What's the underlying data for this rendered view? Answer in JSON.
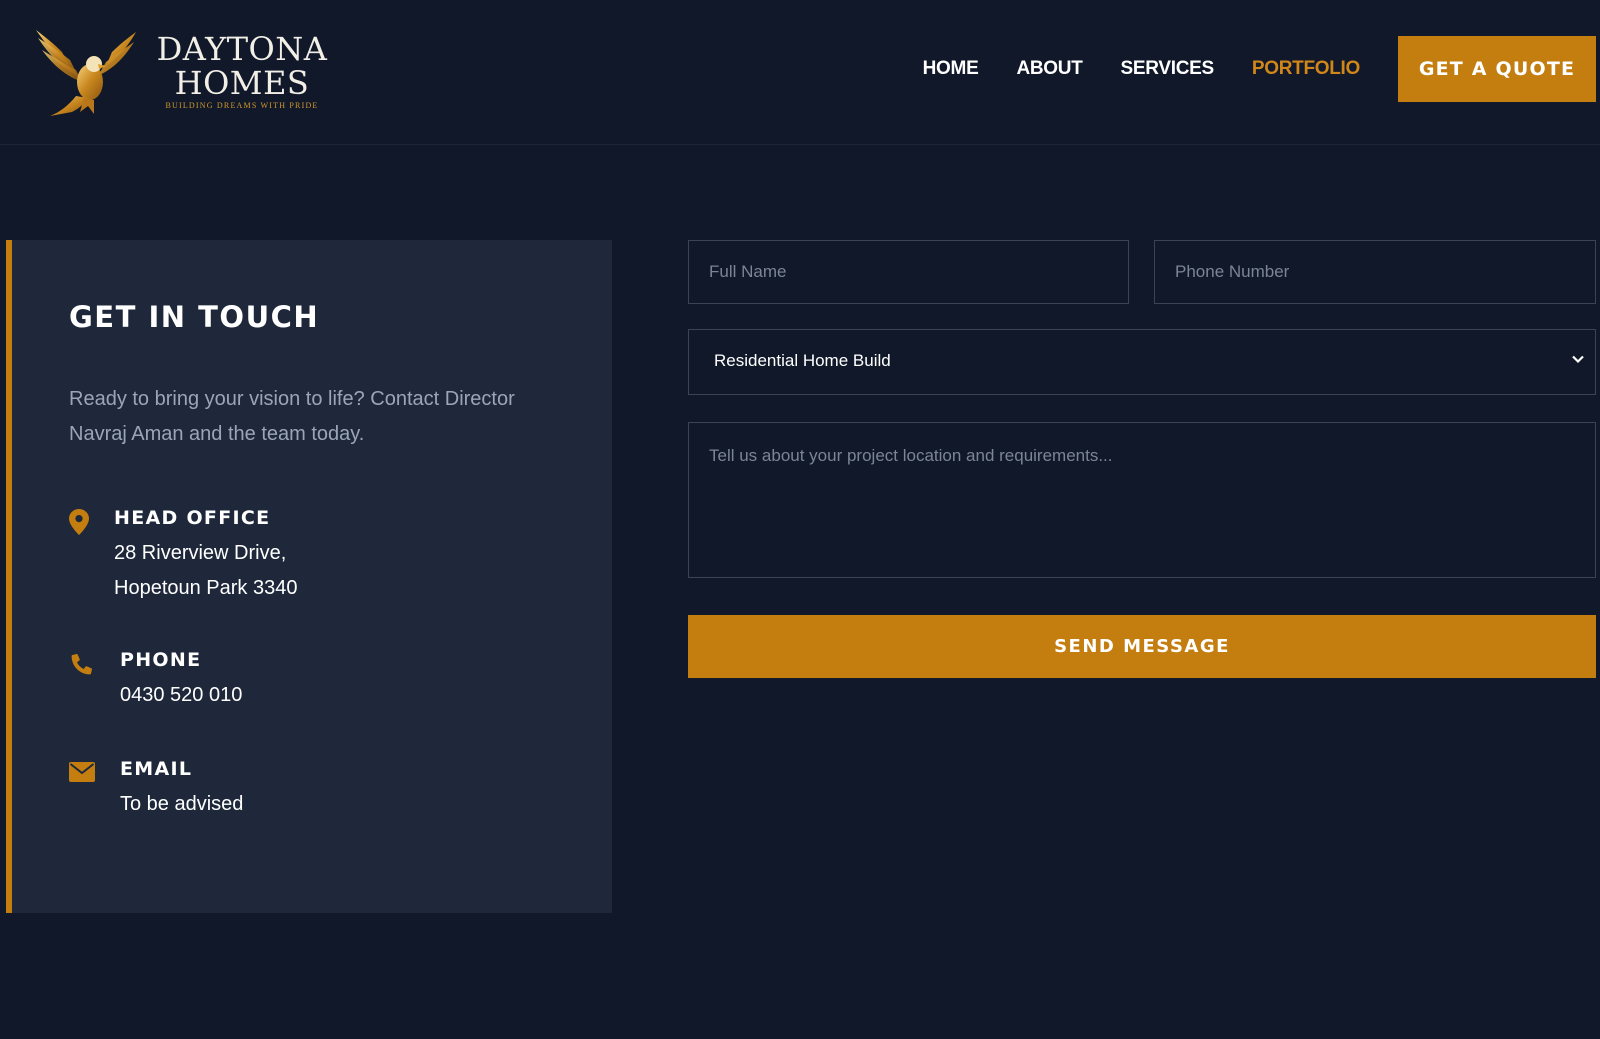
{
  "brand": {
    "line1": "DAYTONA",
    "line2": "HOMES",
    "tagline": "BUILDING DREAMS WITH PRIDE",
    "logo_icon": "eagle-icon"
  },
  "nav": {
    "items": [
      {
        "label": "HOME",
        "active": false
      },
      {
        "label": "ABOUT",
        "active": false
      },
      {
        "label": "SERVICES",
        "active": false
      },
      {
        "label": "PORTFOLIO",
        "active": true
      }
    ],
    "cta_label": "GET A QUOTE"
  },
  "contact": {
    "title": "GET IN TOUCH",
    "description": "Ready to bring your vision to life? Contact Director Navraj Aman and the team today.",
    "office": {
      "label": "HEAD OFFICE",
      "line1": "28 Riverview Drive,",
      "line2": "Hopetoun Park 3340",
      "icon": "map-pin-icon"
    },
    "phone": {
      "label": "PHONE",
      "value": "0430 520 010",
      "icon": "phone-icon"
    },
    "email": {
      "label": "EMAIL",
      "value": "To be advised",
      "icon": "envelope-icon"
    }
  },
  "form": {
    "name_placeholder": "Full Name",
    "phone_placeholder": "Phone Number",
    "service_selected": "Residential Home Build",
    "message_placeholder": "Tell us about your project location and requirements...",
    "submit_label": "SEND MESSAGE"
  },
  "colors": {
    "background": "#101829",
    "card": "#1e283a",
    "accent": "#c47d0f",
    "active_nav": "#d1861a"
  }
}
